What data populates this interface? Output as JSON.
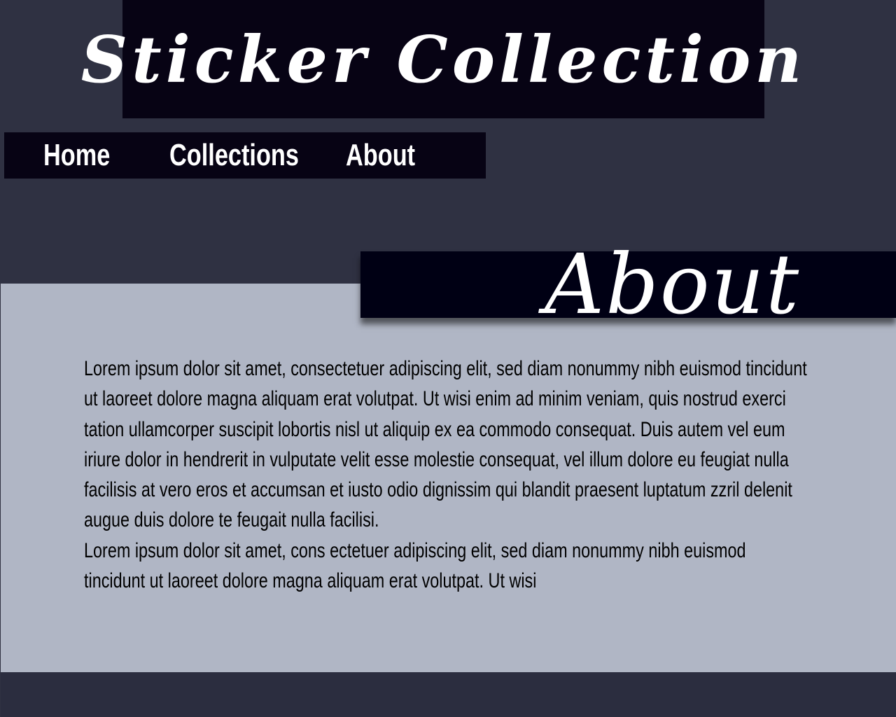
{
  "header": {
    "site_title": "Sticker Collection"
  },
  "nav": {
    "items": [
      {
        "label": "Home"
      },
      {
        "label": "Collections"
      },
      {
        "label": "About"
      }
    ]
  },
  "section": {
    "title": "About"
  },
  "content": {
    "paragraphs": [
      "Lorem ipsum dolor sit amet, consectetuer adipiscing elit, sed diam nonummy nibh euismod tincidunt ut laoreet dolore magna aliquam erat volutpat. Ut wisi enim ad minim veniam, quis nostrud exerci tation ullamcorper suscipit lobortis nisl ut aliquip ex ea commodo consequat. Duis autem vel eum iriure dolor in hendrerit in vulputate velit esse molestie consequat, vel illum dolore eu feugiat nulla facilisis at vero eros et accumsan et iusto odio dignissim qui blandit praesent luptatum zzril delenit augue duis dolore te feugait nulla facilisi.",
      "Lorem ipsum dolor sit amet, cons ectetuer adipiscing elit, sed diam nonummy nibh euismod tincidunt ut laoreet dolore magna aliquam erat volutpat. Ut wisi"
    ]
  },
  "colors": {
    "page_background": "#2f3142",
    "banner_background": "#070314",
    "content_background": "#b0b6c5",
    "footer_background": "#2b2d3f",
    "heading_text": "#ffffff",
    "body_text": "#000000"
  }
}
